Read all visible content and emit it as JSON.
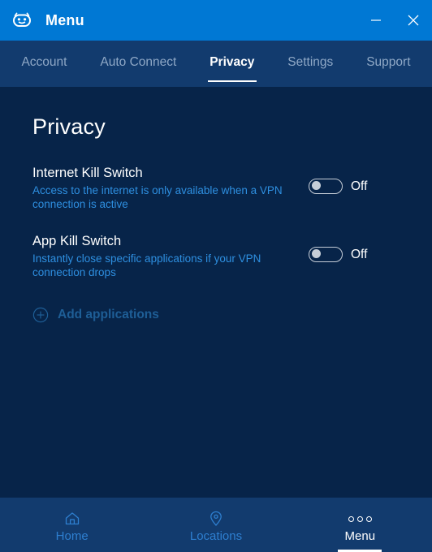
{
  "window": {
    "title": "Menu",
    "logo_icon": "robot-head-icon",
    "minimize_label": "–",
    "close_label": "✕",
    "colors": {
      "titlebar": "#0078D4",
      "tabbar": "#123B6E",
      "content": "#072449",
      "bottomnav": "#123B6E",
      "accent_link": "#2E8FE0"
    }
  },
  "tabs": [
    {
      "label": "Account",
      "active": false
    },
    {
      "label": "Auto Connect",
      "active": false
    },
    {
      "label": "Privacy",
      "active": true
    },
    {
      "label": "Settings",
      "active": false
    },
    {
      "label": "Support",
      "active": false
    }
  ],
  "page": {
    "title": "Privacy",
    "settings": [
      {
        "title": "Internet Kill Switch",
        "description": "Access to the internet is only available when a VPN connection is active",
        "toggle_state": "Off"
      },
      {
        "title": "App Kill Switch",
        "description": "Instantly close specific applications if your VPN connection drops",
        "toggle_state": "Off"
      }
    ],
    "add_applications": {
      "label": "Add applications",
      "icon": "plus-circle-icon",
      "enabled": false
    }
  },
  "bottom_nav": [
    {
      "label": "Home",
      "icon": "home-icon",
      "active": false
    },
    {
      "label": "Locations",
      "icon": "map-pin-icon",
      "active": false
    },
    {
      "label": "Menu",
      "icon": "three-dots-icon",
      "active": true
    }
  ]
}
